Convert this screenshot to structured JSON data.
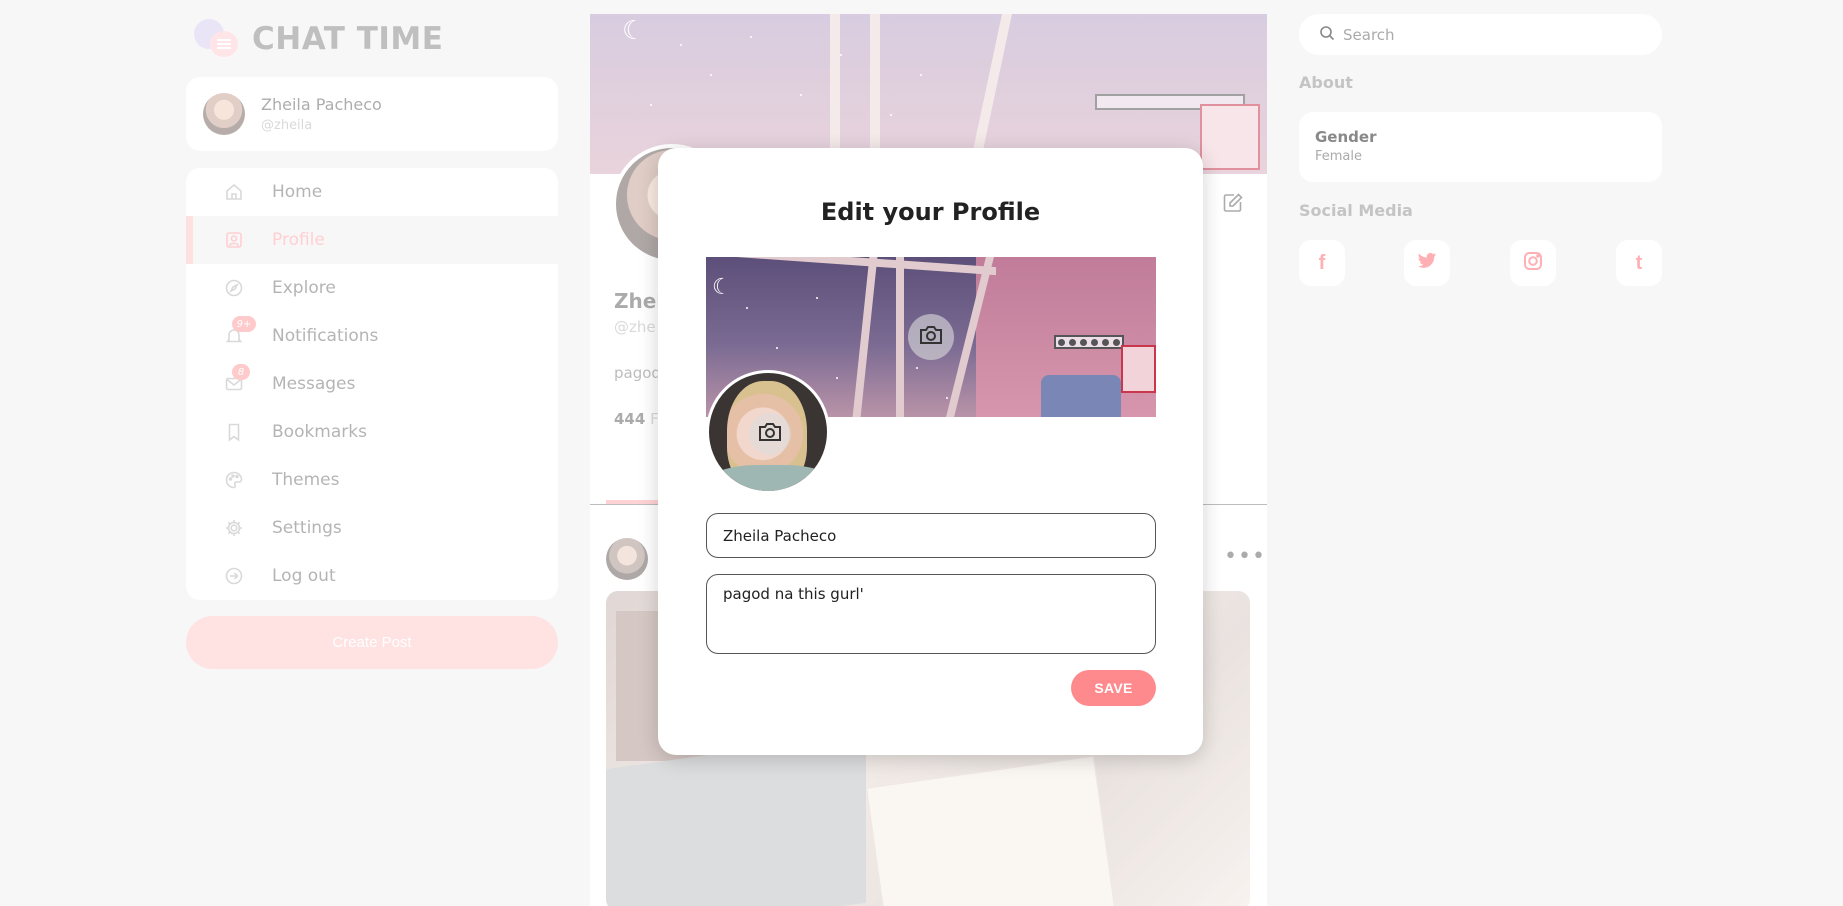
{
  "app": {
    "title": "CHAT TIME"
  },
  "user": {
    "name": "Zheila Pacheco",
    "handle": "@zheila"
  },
  "nav": {
    "items": [
      {
        "label": "Home",
        "icon": "home-icon"
      },
      {
        "label": "Profile",
        "icon": "profile-icon",
        "active": true
      },
      {
        "label": "Explore",
        "icon": "compass-icon"
      },
      {
        "label": "Notifications",
        "icon": "bell-icon",
        "badge": "9+"
      },
      {
        "label": "Messages",
        "icon": "mail-icon",
        "badge": "8"
      },
      {
        "label": "Bookmarks",
        "icon": "bookmark-icon"
      },
      {
        "label": "Themes",
        "icon": "palette-icon"
      },
      {
        "label": "Settings",
        "icon": "gear-icon"
      },
      {
        "label": "Log out",
        "icon": "logout-icon"
      }
    ],
    "create_post": "Create Post"
  },
  "profile": {
    "name_partial": "Zheil",
    "handle_partial": "@zhe",
    "bio_partial": "pagod",
    "followers_count": "444",
    "followers_partial": "Fo"
  },
  "modal": {
    "title": "Edit your Profile",
    "name_value": "Zheila Pacheco",
    "bio_value": "pagod na this gurl'",
    "save_label": "SAVE"
  },
  "right": {
    "search_placeholder": "Search",
    "about_title": "About",
    "about": {
      "label": "Gender",
      "value": "Female"
    },
    "social_title": "Social Media",
    "social": [
      {
        "name": "facebook",
        "glyph": "f"
      },
      {
        "name": "twitter",
        "glyph": "t"
      },
      {
        "name": "instagram",
        "glyph": "ig"
      },
      {
        "name": "tumblr",
        "glyph": "t"
      }
    ]
  },
  "colors": {
    "accent": "#ff8a8e",
    "accent_light": "#ffc6c8",
    "background": "#f0f1f3"
  }
}
